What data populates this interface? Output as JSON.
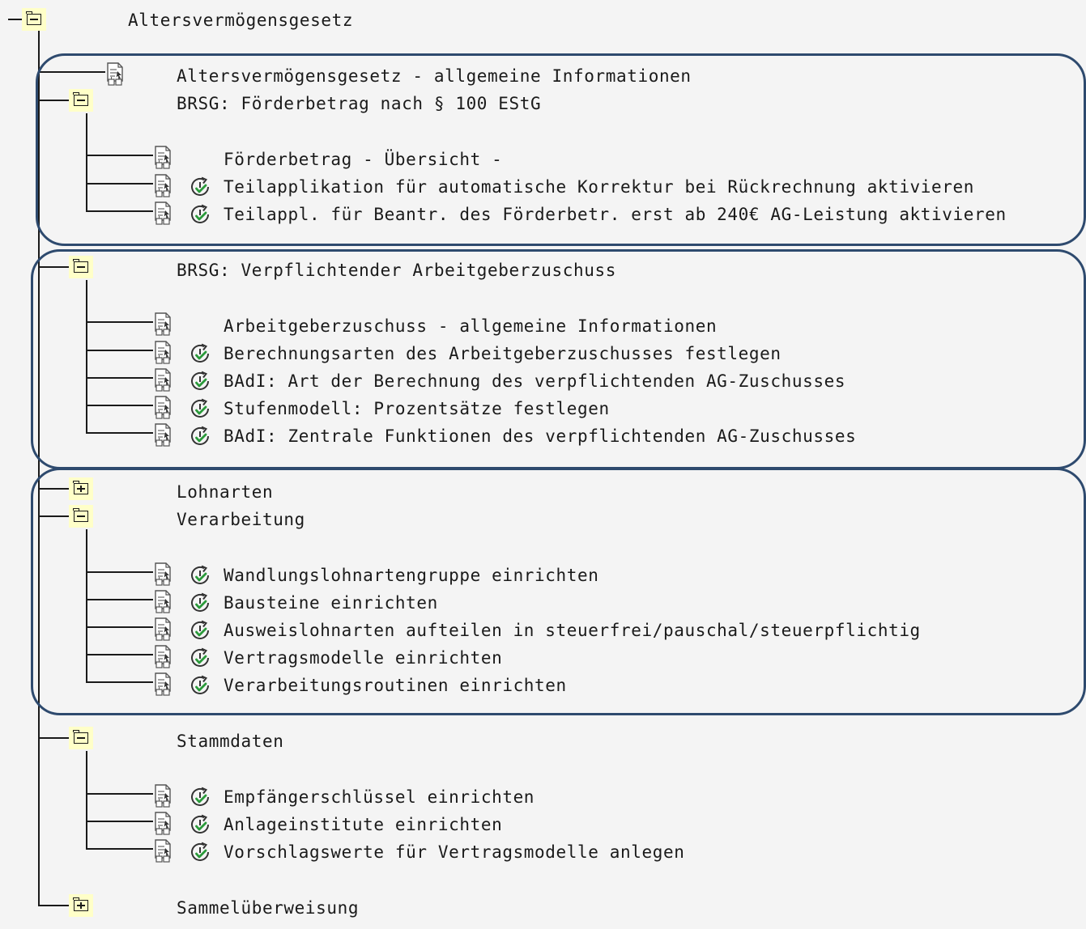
{
  "root": {
    "label": "Altersvermögensgesetz"
  },
  "nodes": {
    "allg_info": "Altersvermögensgesetz - allgemeine Informationen",
    "brsg_foerder": "BRSG: Förderbetrag nach § 100 EStG",
    "foerder_uebersicht": "Förderbetrag - Übersicht -",
    "teilapp_korrektur": "Teilapplikation für automatische Korrektur bei Rückrechnung aktivieren",
    "teilapp_240": "Teilappl. für Beantr. des Förderbetr. erst ab 240€ AG-Leistung aktivieren",
    "brsg_ag": "BRSG: Verpflichtender Arbeitgeberzuschuss",
    "ag_allg_info": "Arbeitgeberzuschuss - allgemeine Informationen",
    "berechnungsarten": "Berechnungsarten des Arbeitgeberzuschusses festlegen",
    "badi_art": "BAdI: Art der Berechnung des verpflichtenden AG-Zuschusses",
    "stufenmodell": "Stufenmodell: Prozentsätze festlegen",
    "badi_zentral": "BAdI: Zentrale Funktionen des verpflichtenden AG-Zuschusses",
    "lohnarten": "Lohnarten",
    "verarbeitung": "Verarbeitung",
    "wandlung": "Wandlungslohnartengruppe einrichten",
    "bausteine": "Bausteine einrichten",
    "ausweis": "Ausweislohnarten aufteilen in steuerfrei/pauschal/steuerpflichtig",
    "vertragsmodelle": "Vertragsmodelle einrichten",
    "verarbeitungsroutinen": "Verarbeitungsroutinen einrichten",
    "stammdaten": "Stammdaten",
    "empfaenger": "Empfängerschlüssel einrichten",
    "anlage": "Anlageinstitute einrichten",
    "vorschlag": "Vorschlagswerte für Vertragsmodelle anlegen",
    "sammel": "Sammelüberweisung"
  },
  "colors": {
    "folder_bg": "#ffffc8",
    "frame": "#2e4a6e",
    "exec_check": "#2a9a3a",
    "line": "#1a1a1a"
  },
  "icons": {
    "folder_open": "folder-open-icon",
    "folder_closed": "folder-closed-icon",
    "doc": "documentation-icon",
    "exec": "execute-activity-icon"
  }
}
